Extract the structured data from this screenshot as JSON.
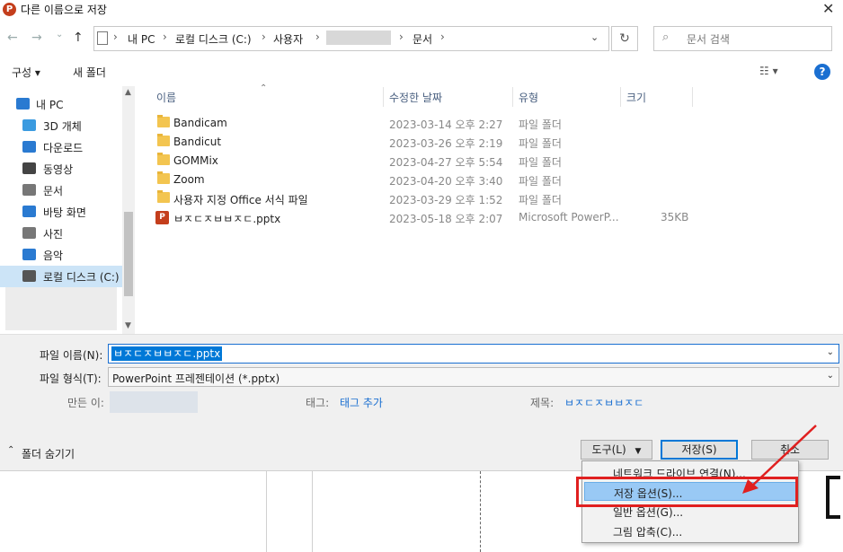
{
  "window": {
    "title": "다른 이름으로 저장",
    "close_glyph": "✕"
  },
  "nav": {
    "breadcrumbs": [
      "내 PC",
      "로컬 디스크 (C:)",
      "사용자",
      "문서"
    ],
    "search_placeholder": "문서 검색",
    "back_glyph": "←",
    "forward_glyph": "→",
    "up_glyph": "↑",
    "dropdown_glyph": "⌄",
    "refresh_glyph": "↻"
  },
  "toolbar": {
    "organize": "구성 ▾",
    "new_folder": "새 폴더",
    "view_glyph": "☷ ▾",
    "help": "?"
  },
  "sidebar": {
    "items": [
      {
        "label": "내 PC",
        "icon": "pc-icon",
        "color": "#2a7ad1"
      },
      {
        "label": "3D 개체",
        "icon": "cube-icon",
        "color": "#3b9be0"
      },
      {
        "label": "다운로드",
        "icon": "download-icon",
        "color": "#2a7ad1"
      },
      {
        "label": "동영상",
        "icon": "film-icon",
        "color": "#444444"
      },
      {
        "label": "문서",
        "icon": "document-icon",
        "color": "#777777"
      },
      {
        "label": "바탕 화면",
        "icon": "desktop-icon",
        "color": "#2a7ad1"
      },
      {
        "label": "사진",
        "icon": "picture-icon",
        "color": "#777777"
      },
      {
        "label": "음악",
        "icon": "music-icon",
        "color": "#2a7ad1"
      },
      {
        "label": "로컬 디스크 (C:)",
        "icon": "disk-icon",
        "color": "#555555"
      }
    ]
  },
  "columns": {
    "name": "이름",
    "modified": "수정한 날짜",
    "type": "유형",
    "size": "크기"
  },
  "files": [
    {
      "name": "Bandicam",
      "modified": "2023-03-14 오후 2:27",
      "type": "파일 폴더",
      "size": "",
      "kind": "folder"
    },
    {
      "name": "Bandicut",
      "modified": "2023-03-26 오후 2:19",
      "type": "파일 폴더",
      "size": "",
      "kind": "folder"
    },
    {
      "name": "GOMMix",
      "modified": "2023-04-27 오후 5:54",
      "type": "파일 폴더",
      "size": "",
      "kind": "folder"
    },
    {
      "name": "Zoom",
      "modified": "2023-04-20 오후 3:40",
      "type": "파일 폴더",
      "size": "",
      "kind": "folder"
    },
    {
      "name": "사용자 지정 Office 서식 파일",
      "modified": "2023-03-29 오후 1:52",
      "type": "파일 폴더",
      "size": "",
      "kind": "folder"
    },
    {
      "name": "ㅂㅈㄷㅈㅂㅂㅈㄷ.pptx",
      "modified": "2023-05-18 오후 2:07",
      "type": "Microsoft PowerP...",
      "size": "35KB",
      "kind": "pptx"
    }
  ],
  "form": {
    "filename_label": "파일 이름(N):",
    "filename_value": "ㅂㅈㄷㅈㅂㅂㅈㄷ.pptx",
    "filetype_label": "파일 형식(T):",
    "filetype_value": "PowerPoint 프레젠테이션 (*.pptx)",
    "author_label": "만든 이:",
    "tags_label": "태그:",
    "tags_value": "태그 추가",
    "title_label": "제목:",
    "title_value": "ㅂㅈㄷㅈㅂㅂㅈㄷ",
    "hide_folders": "폴더 숨기기",
    "tools_button": "도구(L)",
    "save_button": "저장(S)",
    "cancel_button": "취소"
  },
  "tools_menu": [
    "네트워크 드라이브 연결(N)...",
    "저장 옵션(S)...",
    "일반 옵션(G)...",
    "그림 압축(C)..."
  ],
  "colors": {
    "accent": "#0078d7",
    "highlight": "#99c9f5",
    "annotation": "#e02020",
    "link": "#1a6fd1"
  }
}
